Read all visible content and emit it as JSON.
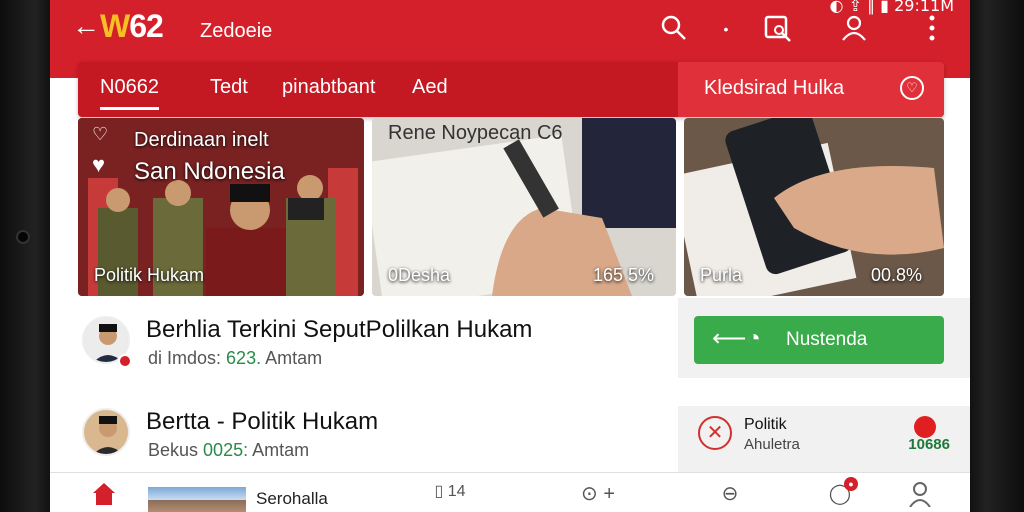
{
  "status_bar": {
    "time": "29:11M",
    "icons": "◐ ⇪ ∥ ▮"
  },
  "header": {
    "back_icon": "arrow-left-icon",
    "logo_w": "W",
    "logo_rest": "62",
    "title": "Zedoeie",
    "icons": [
      "search-icon",
      "dot-icon",
      "edit-search-icon",
      "user-icon",
      "more-icon"
    ]
  },
  "tabs": [
    {
      "label": "N0662",
      "active": true
    },
    {
      "label": "Tedt",
      "active": false
    },
    {
      "label": "pinabtbant",
      "active": false
    },
    {
      "label": "Aed",
      "active": false
    }
  ],
  "tab_right": {
    "label": "Kledsirad Hulka"
  },
  "cards": [
    {
      "caption_line1": "Derdinaan inelt",
      "caption_line2": "San Ndonesia",
      "label": "Politik Hukam",
      "number": ""
    },
    {
      "caption": "Rene Noypecan C6",
      "label": "0Desha",
      "number": "165 5%"
    },
    {
      "caption": "",
      "label": "Purla",
      "number": "00.8%"
    }
  ],
  "news": [
    {
      "title": "Berhlia Terkini SeputPolilkan Hukam",
      "meta_prefix": "di Imdos:",
      "meta_highlight": "623.",
      "meta_suffix": "Amtam"
    },
    {
      "title": "Bertta - Politik Hukam",
      "meta_prefix": "Bekus",
      "meta_highlight": "0025:",
      "meta_suffix": "Amtam"
    }
  ],
  "side": {
    "button_label": "Nustenda",
    "category_title": "Politik",
    "category_sub": "Ahuletra",
    "category_count": "10686"
  },
  "bottom_nav": {
    "home_icon": "home-icon",
    "label": "Serohalla",
    "page_text": "14"
  },
  "colors": {
    "brand_red": "#d3202b",
    "accent_green": "#3aab4a",
    "logo_yellow": "#f6c024"
  }
}
